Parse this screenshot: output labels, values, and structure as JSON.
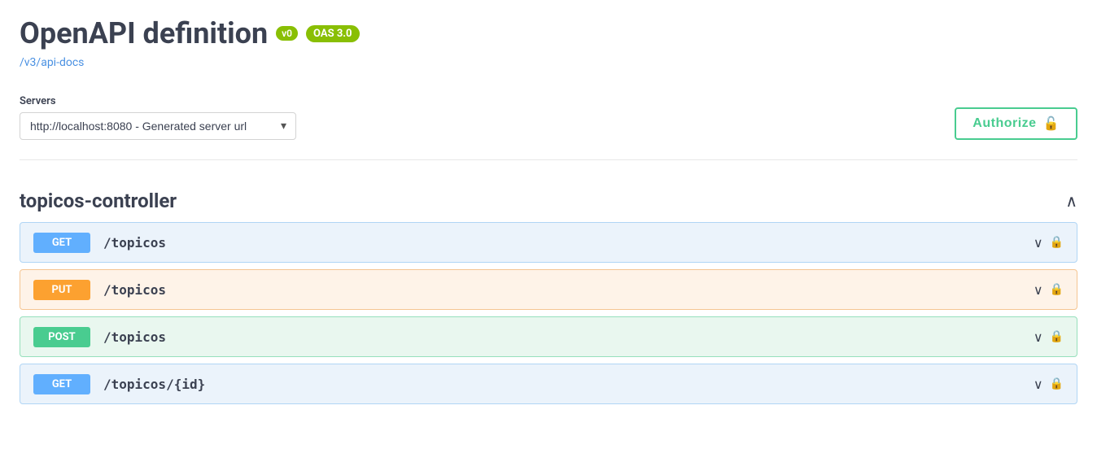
{
  "header": {
    "title": "OpenAPI definition",
    "badge_v0": "v0",
    "badge_oas": "OAS 3.0",
    "api_link_text": "/v3/api-docs",
    "api_link_href": "/v3/api-docs"
  },
  "servers": {
    "label": "Servers",
    "options": [
      "http://localhost:8080 - Generated server url"
    ],
    "selected": "http://localhost:8080 - Generated server url"
  },
  "authorize_button": {
    "label": "Authorize",
    "lock_icon": "🔓"
  },
  "controller": {
    "name": "topicos-controller",
    "chevron": "∧",
    "endpoints": [
      {
        "method": "GET",
        "path": "/topicos",
        "method_class": "method-get",
        "row_class": "row-get"
      },
      {
        "method": "PUT",
        "path": "/topicos",
        "method_class": "method-put",
        "row_class": "row-put"
      },
      {
        "method": "POST",
        "path": "/topicos",
        "method_class": "method-post",
        "row_class": "row-post"
      },
      {
        "method": "GET",
        "path": "/topicos/{id}",
        "method_class": "method-get",
        "row_class": "row-get"
      }
    ]
  },
  "icons": {
    "chevron_down": "∨",
    "lock_small": "🔒"
  }
}
